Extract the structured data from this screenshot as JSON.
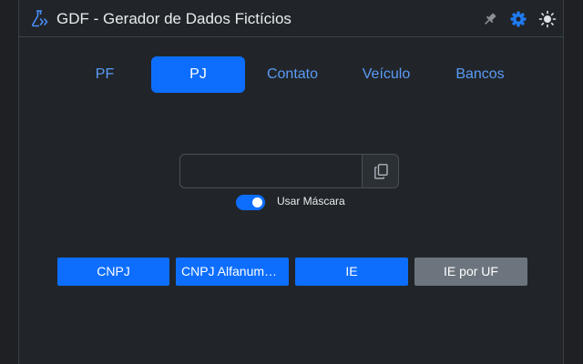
{
  "app": {
    "title": "GDF - Gerador de Dados Fictícios"
  },
  "header_icons": [
    "pin-icon",
    "gear-icon",
    "sun-icon"
  ],
  "tabs": [
    {
      "label": "PF",
      "active": false
    },
    {
      "label": "PJ",
      "active": true
    },
    {
      "label": "Contato",
      "active": false
    },
    {
      "label": "Veículo",
      "active": false
    },
    {
      "label": "Bancos",
      "active": false
    }
  ],
  "generator": {
    "value": "",
    "placeholder": "",
    "copy_icon": "copy-icon",
    "mask_label": "Usar Máscara",
    "mask_enabled": true
  },
  "actions": [
    {
      "label": "CNPJ",
      "variant": "primary"
    },
    {
      "label": "CNPJ Alfanumérico",
      "variant": "primary"
    },
    {
      "label": "IE",
      "variant": "primary"
    },
    {
      "label": "IE por UF",
      "variant": "secondary"
    }
  ],
  "colors": {
    "accent": "#0d6efd",
    "secondary": "#6c757d",
    "background": "#212529",
    "tab_text": "#5a9bf6"
  }
}
